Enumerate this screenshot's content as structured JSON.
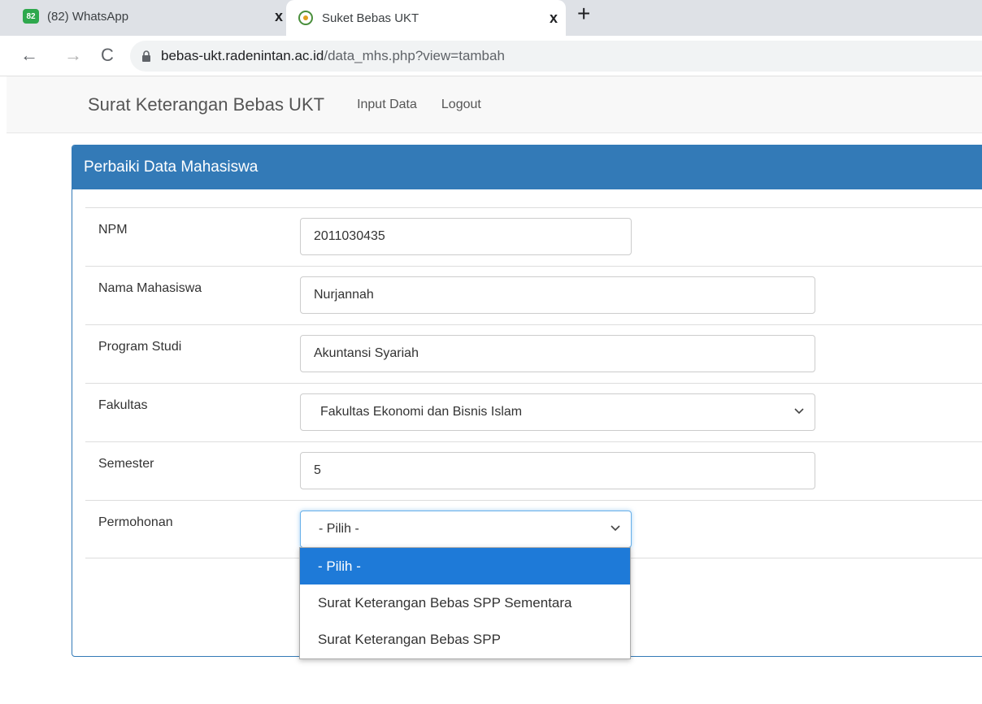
{
  "browser": {
    "tabs": [
      {
        "badge": "82",
        "title": "(82) WhatsApp",
        "close": "x"
      },
      {
        "title": "Suket Bebas UKT",
        "close": "x"
      }
    ],
    "new_tab": "+",
    "back": "←",
    "forward": "→",
    "reload": "C",
    "url_host": "bebas-ukt.radenintan.ac.id",
    "url_path": "/data_mhs.php?view=tambah"
  },
  "navbar": {
    "brand": "Surat Keterangan Bebas UKT",
    "links": [
      "Input Data",
      "Logout"
    ]
  },
  "panel": {
    "title": "Perbaiki Data Mahasiswa"
  },
  "form": {
    "npm": {
      "label": "NPM",
      "value": "2011030435"
    },
    "nama": {
      "label": "Nama Mahasiswa",
      "value": "Nurjannah"
    },
    "prodi": {
      "label": "Program Studi",
      "value": "Akuntansi Syariah"
    },
    "fakultas": {
      "label": "Fakultas",
      "value": "Fakultas Ekonomi dan Bisnis Islam"
    },
    "semester": {
      "label": "Semester",
      "value": "5"
    },
    "permohonan": {
      "label": "Permohonan",
      "value": "- Pilih -",
      "options": [
        "- Pilih -",
        "Surat Keterangan Bebas SPP Sementara",
        "Surat Keterangan Bebas SPP"
      ]
    }
  },
  "colors": {
    "primary": "#337ab7",
    "selected_option": "#1e7ad8"
  }
}
